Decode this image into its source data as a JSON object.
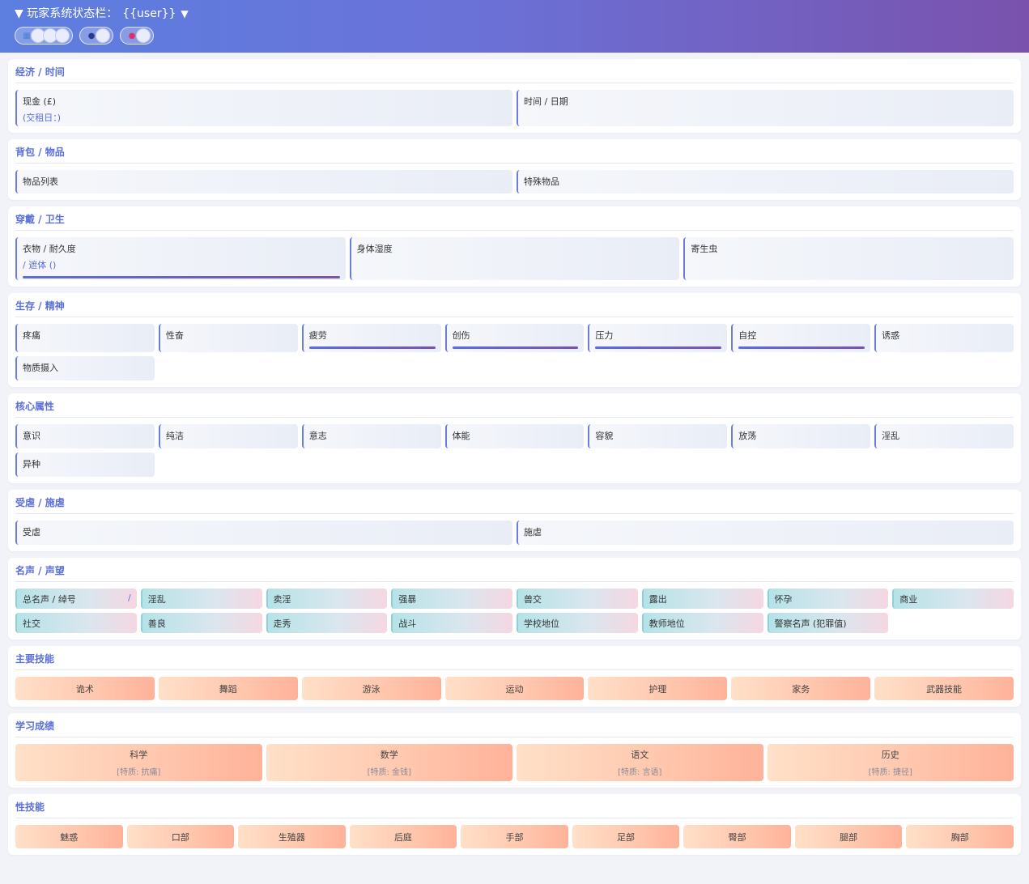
{
  "header": {
    "title_prefix": "▼ 玩家系统状态栏：",
    "user": "{{user}}",
    "title_suffix": "▼",
    "pills": [
      {
        "icon": "calendar-icon",
        "circles": 3
      },
      {
        "icon": "user-icon",
        "circles": 1
      },
      {
        "icon": "pin-icon",
        "circles": 1
      }
    ]
  },
  "economy": {
    "title": "经济 / 时间",
    "cash_label": "现金 (£)",
    "rent_label": "(交租日：)",
    "time_label": "时间 / 日期"
  },
  "bag": {
    "title": "背包 / 物品",
    "items_label": "物品列表",
    "special_label": "特殊物品"
  },
  "wear": {
    "title": "穿戴 / 卫生",
    "clothes_label": "衣物 / 耐久度",
    "cover_label": "/ 遮体 ()",
    "wetness_label": "身体湿度",
    "parasite_label": "寄生虫"
  },
  "survival": {
    "title": "生存 / 精神",
    "items": [
      {
        "label": "疼痛",
        "bar": false
      },
      {
        "label": "性奋",
        "bar": false
      },
      {
        "label": "疲劳",
        "bar": true
      },
      {
        "label": "创伤",
        "bar": true
      },
      {
        "label": "压力",
        "bar": true
      },
      {
        "label": "自控",
        "bar": true
      },
      {
        "label": "诱惑",
        "bar": false
      },
      {
        "label": "物质摄入",
        "bar": false
      }
    ]
  },
  "core": {
    "title": "核心属性",
    "items": [
      "意识",
      "纯洁",
      "意志",
      "体能",
      "容貌",
      "放荡",
      "淫乱",
      "异种"
    ]
  },
  "abuse": {
    "title": "受虐 / 施虐",
    "masochism_label": "受虐",
    "sadism_label": "施虐"
  },
  "fame": {
    "title": "名声 / 声望",
    "total_label": "总名声 / 绰号",
    "total_slash": "/",
    "items": [
      "淫乱",
      "卖淫",
      "强暴",
      "兽交",
      "露出",
      "怀孕",
      "商业",
      "社交",
      "善良",
      "走秀",
      "战斗",
      "学校地位",
      "教师地位",
      "警察名声 (犯罪值)"
    ]
  },
  "skills": {
    "title": "主要技能",
    "items": [
      "诡术",
      "舞蹈",
      "游泳",
      "运动",
      "护理",
      "家务",
      "武器技能"
    ]
  },
  "study": {
    "title": "学习成绩",
    "items": [
      {
        "subject": "科学",
        "trait": "[特质: 抗痛]"
      },
      {
        "subject": "数学",
        "trait": "[特质: 金钱]"
      },
      {
        "subject": "语文",
        "trait": "[特质: 言语]"
      },
      {
        "subject": "历史",
        "trait": "[特质: 捷径]"
      }
    ]
  },
  "sex_skills": {
    "title": "性技能",
    "items": [
      "魅惑",
      "口部",
      "生殖器",
      "后庭",
      "手部",
      "足部",
      "臀部",
      "腿部",
      "胸部"
    ]
  }
}
